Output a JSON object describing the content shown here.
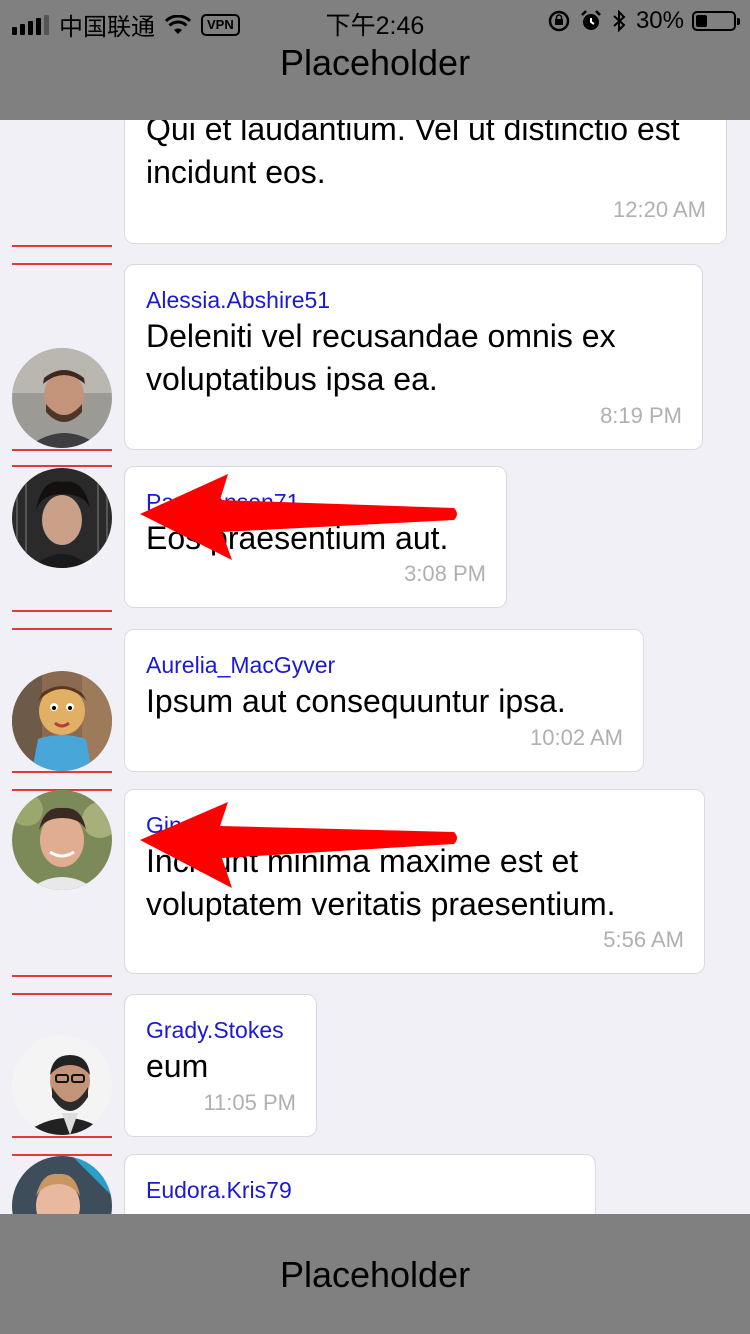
{
  "status_bar": {
    "carrier": "中国联通",
    "vpn": "VPN",
    "time": "下午2:46",
    "battery": "30%",
    "battery_level": 0.3
  },
  "header": {
    "title": "Placeholder"
  },
  "footer": {
    "title": "Placeholder"
  },
  "messages": [
    {
      "username": "",
      "text": "Qui et laudantium. Vel ut distinctio est incidunt eos.",
      "time": "12:20 AM"
    },
    {
      "username": "Alessia.Abshire51",
      "text": "Deleniti vel recusandae omnis ex voluptatibus ipsa ea.",
      "time": "8:19 PM"
    },
    {
      "username": "Par  Hansen71",
      "text": "Eos praesentium aut.",
      "time": "3:08 PM"
    },
    {
      "username": "Aurelia_MacGyver",
      "text": "Ipsum aut consequuntur ipsa.",
      "time": "10:02 AM"
    },
    {
      "username": "Gin",
      "text": "Incidunt minima maxime est et voluptatem veritatis praesentium.",
      "time": "5:56 AM"
    },
    {
      "username": "Grady.Stokes",
      "text": "eum",
      "time": "11:05 PM"
    },
    {
      "username": "Eudora.Kris79",
      "text": "",
      "time": ""
    }
  ],
  "colors": {
    "username": "#1a1ad0",
    "annotation_arrow": "#ff0000",
    "divider": "#e23a3a",
    "bar": "#808080"
  }
}
